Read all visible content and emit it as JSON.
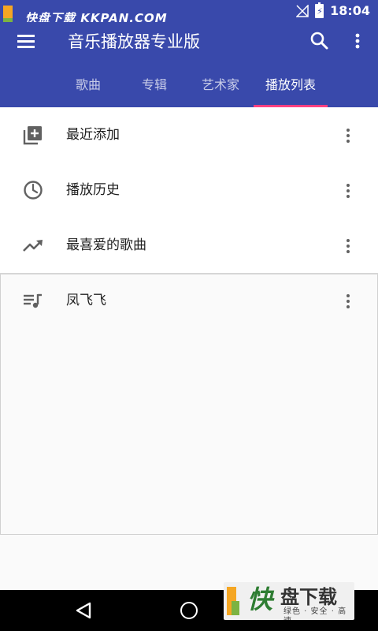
{
  "status_bar": {
    "watermark_text": "快盘下载 KKPAN.COM",
    "time": "18:04",
    "battery_glyph": "⚡",
    "icons": [
      "no-signal-icon",
      "battery-charging-icon"
    ]
  },
  "app_bar": {
    "title": "音乐播放器专业版",
    "icons": [
      "menu-icon",
      "search-icon",
      "more-vert-icon"
    ]
  },
  "tabs": [
    {
      "label": "歌曲",
      "active": false
    },
    {
      "label": "专辑",
      "active": false
    },
    {
      "label": "艺术家",
      "active": false
    },
    {
      "label": "播放列表",
      "active": true
    }
  ],
  "playlists": {
    "smart": [
      {
        "label": "最近添加",
        "icon": "playlist-add-icon"
      },
      {
        "label": "播放历史",
        "icon": "clock-icon"
      },
      {
        "label": "最喜爱的歌曲",
        "icon": "trending-up-icon"
      }
    ],
    "user": [
      {
        "label": "凤飞飞",
        "icon": "queue-music-icon"
      }
    ]
  },
  "promo": {
    "big1": "快",
    "big2": "盘下载",
    "small": "绿色 · 安全 · 高速"
  },
  "colors": {
    "primary": "#3949ab",
    "accent": "#ff4081",
    "text": "#212121",
    "icon": "#616161"
  }
}
